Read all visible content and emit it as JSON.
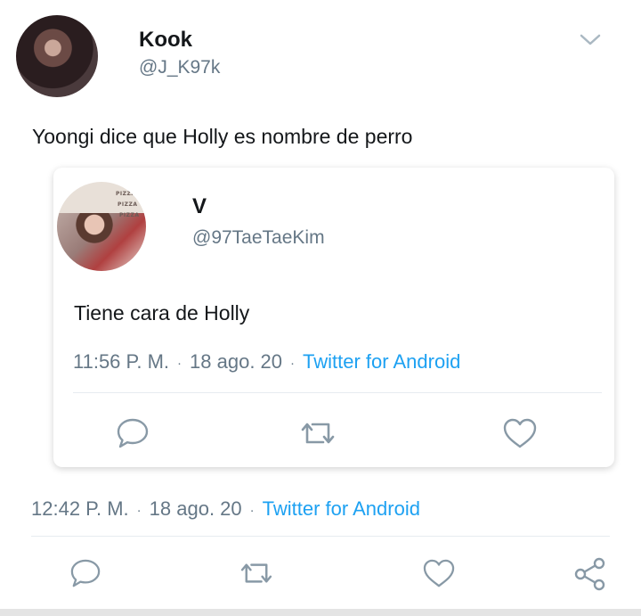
{
  "tweet": {
    "author": {
      "name": "Kook",
      "handle": "@J_K97k"
    },
    "text": "Yoongi dice que Holly es nombre de perro",
    "meta": {
      "time": "12:42 P. M.",
      "date": "18 ago. 20",
      "source": "Twitter for Android",
      "separator": "·"
    },
    "actions": [
      "reply-icon",
      "retweet-icon",
      "like-icon",
      "share-icon"
    ],
    "more_icon": "chevron-down-icon"
  },
  "quoted": {
    "author": {
      "name": "V",
      "handle": "@97TaeTaeKim"
    },
    "avatar_text": [
      "PIZZA",
      "PIZZA",
      "PIZZA"
    ],
    "text": "Tiene cara de Holly",
    "meta": {
      "time": "11:56 P. M.",
      "date": "18 ago. 20",
      "source": "Twitter for Android",
      "separator": "·"
    },
    "actions": [
      "reply-icon",
      "retweet-icon",
      "like-icon"
    ]
  },
  "colors": {
    "link": "#1da1f2",
    "secondary": "#657786",
    "primary": "#14171a",
    "divider": "#e6ecf0"
  }
}
